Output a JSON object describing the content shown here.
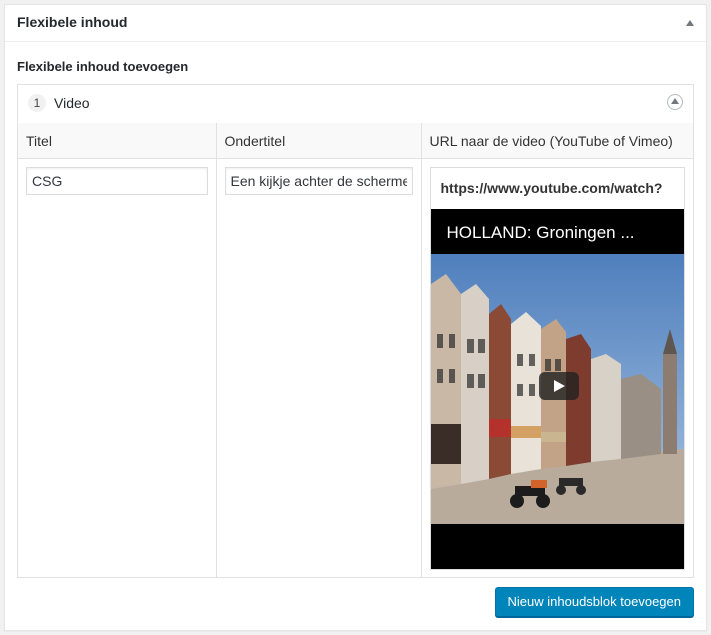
{
  "metabox": {
    "title": "Flexibele inhoud"
  },
  "field": {
    "label": "Flexibele inhoud toevoegen"
  },
  "layout": {
    "order": "1",
    "name": "Video",
    "columns": {
      "title": "Titel",
      "subtitle": "Ondertitel",
      "url": "URL naar de video (YouTube of Vimeo)"
    },
    "values": {
      "title": "CSG",
      "subtitle": "Een kijkje achter de schermen",
      "url": "https://www.youtube.com/watch?"
    },
    "video": {
      "title": "HOLLAND: Groningen ..."
    }
  },
  "actions": {
    "add_label": "Nieuw inhoudsblok toevoegen"
  },
  "colors": {
    "primary_button": "#0085ba",
    "border": "#e1e1e1"
  }
}
